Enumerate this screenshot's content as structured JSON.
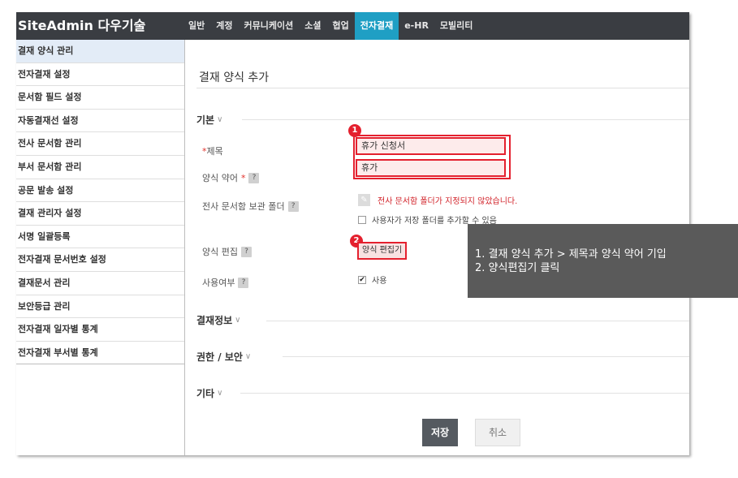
{
  "app": {
    "title": "SiteAdmin 다우기술"
  },
  "topnav": [
    {
      "label": "일반"
    },
    {
      "label": "계정"
    },
    {
      "label": "커뮤니케이션"
    },
    {
      "label": "소셜"
    },
    {
      "label": "협업"
    },
    {
      "label": "전자결재",
      "active": true
    },
    {
      "label": "e-HR"
    },
    {
      "label": "모빌리티"
    }
  ],
  "sidebar": {
    "items": [
      {
        "label": "결재 양식 관리",
        "active": true
      },
      {
        "label": "전자결재 설정"
      },
      {
        "label": "문서함 필드 설정"
      },
      {
        "label": "자동결재선 설정"
      },
      {
        "label": "전사 문서함 관리"
      },
      {
        "label": "부서 문서함 관리"
      },
      {
        "label": "공문 발송 설정"
      },
      {
        "label": "결재 관리자 설정"
      },
      {
        "label": "서명 일괄등록"
      },
      {
        "label": "전자결재 문서번호 설정"
      },
      {
        "label": "결재문서 관리"
      },
      {
        "label": "보안등급 관리"
      },
      {
        "label": "전자결재 일자별 통계"
      },
      {
        "label": "전자결재 부서별 통계"
      }
    ]
  },
  "main": {
    "page_title": "결재 양식 추가",
    "sections": {
      "basic": "기본",
      "approval_info": "결재정보",
      "permission": "권한 / 보안",
      "etc": "기타"
    },
    "form": {
      "title_label": "제목",
      "title_value": "휴가 신청서",
      "abbr_label": "양식 약어",
      "abbr_value": "휴가",
      "folder_label": "전사 문서함 보관 폴더",
      "folder_message": "전사 문서함 폴더가 지정되지 않았습니다.",
      "folder_checkbox": "사용자가 저장 폴더를 추가할 수 있음",
      "editor_label": "양식 편집",
      "editor_button": "양식 편집기",
      "usage_label": "사용여부",
      "usage_checkbox": "사용",
      "required_mark": "*",
      "help_mark": "?"
    },
    "buttons": {
      "save": "저장",
      "cancel": "취소"
    }
  },
  "annotations": {
    "badge1": "1",
    "badge2": "2",
    "callout": [
      "1.  결재 양식 추가 > 제목과 양식 약어 기입",
      "2.  양식편집기 클릭"
    ]
  },
  "colors": {
    "accent": "#1f9fc4",
    "highlight": "#e4202e",
    "topbar": "#3a3d42"
  }
}
